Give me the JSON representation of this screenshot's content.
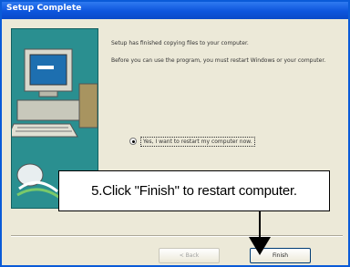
{
  "window": {
    "title": "Setup Complete"
  },
  "content": {
    "heading": "Setup has finished copying files to your computer.",
    "body": "Before you can use the program, you must restart Windows or your computer.",
    "restart_option": {
      "label": "Yes, I want to restart my computer now.",
      "selected": true
    }
  },
  "buttons": {
    "back_label": "< Back",
    "finish_label": "Finish"
  },
  "callout": {
    "text": "5.Click \"Finish\" to restart computer."
  },
  "colors": {
    "titlebar": "#0d55dd",
    "dialog": "#ece9d8",
    "sidebar": "#2a8f90"
  }
}
